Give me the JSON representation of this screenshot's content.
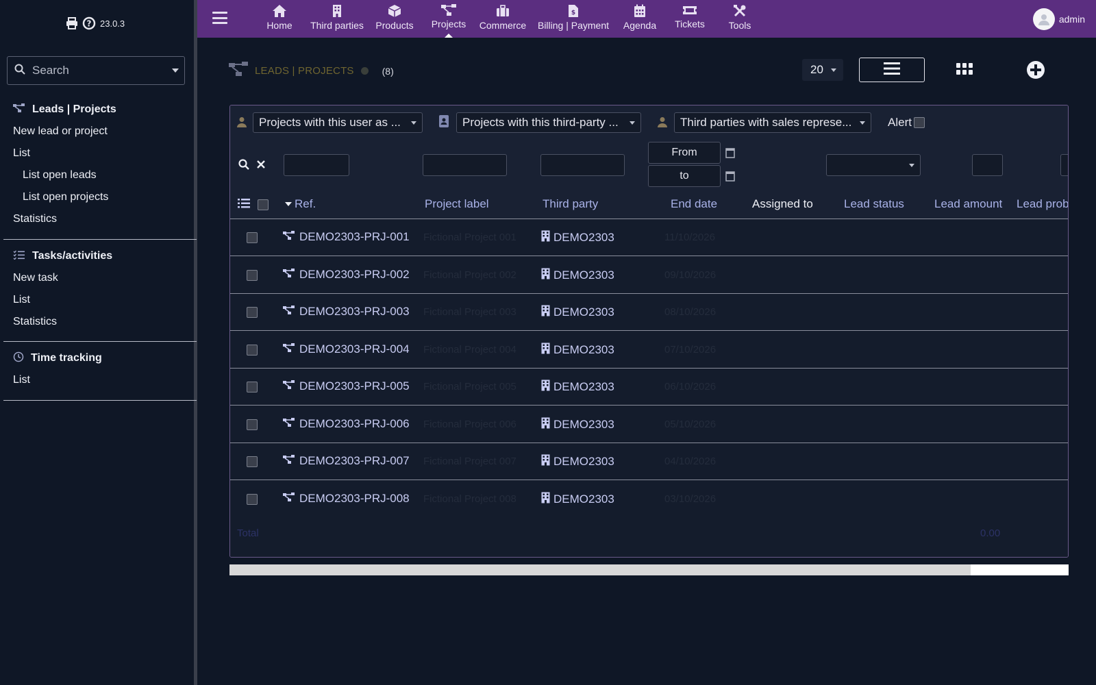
{
  "app": {
    "version": "23.0.3"
  },
  "sidebar": {
    "search_placeholder": "Search",
    "sections": [
      {
        "title": "Leads | Projects",
        "items": [
          {
            "label": "New lead or project",
            "sub": false
          },
          {
            "label": "List",
            "sub": false
          },
          {
            "label": "List open leads",
            "sub": true
          },
          {
            "label": "List open projects",
            "sub": true
          },
          {
            "label": "Statistics",
            "sub": false
          }
        ]
      },
      {
        "title": "Tasks/activities",
        "items": [
          {
            "label": "New task",
            "sub": false
          },
          {
            "label": "List",
            "sub": false
          },
          {
            "label": "Statistics",
            "sub": false
          }
        ]
      },
      {
        "title": "Time tracking",
        "items": [
          {
            "label": "List",
            "sub": false
          }
        ]
      }
    ]
  },
  "topbar": {
    "nav": [
      {
        "label": "Home",
        "icon": "home-icon"
      },
      {
        "label": "Third parties",
        "icon": "building-icon"
      },
      {
        "label": "Products",
        "icon": "cube-icon"
      },
      {
        "label": "Projects",
        "icon": "project-tree-icon",
        "active": true
      },
      {
        "label": "Commerce",
        "icon": "briefcase-icon"
      },
      {
        "label": "Billing | Payment",
        "icon": "invoice-icon"
      },
      {
        "label": "Agenda",
        "icon": "calendar-icon"
      },
      {
        "label": "Tickets",
        "icon": "ticket-icon"
      },
      {
        "label": "Tools",
        "icon": "tools-icon"
      }
    ],
    "user": "admin"
  },
  "page": {
    "title": "LEADS | PROJECTS",
    "count": "(8)",
    "limit": "20"
  },
  "filters": {
    "user_select": "Projects with this user as ...",
    "thirdparty_select": "Projects with this third-party ...",
    "salesrep_select": "Third parties with sales represe...",
    "alert_label": "Alert",
    "date_from": "From",
    "date_to": "to"
  },
  "table": {
    "headers": [
      "Ref.",
      "Project label",
      "Third party",
      "End date",
      "Assigned to",
      "Lead status",
      "Lead amount",
      "Lead prob"
    ],
    "rows": [
      {
        "ref": "DEMO2303-PRJ-001",
        "label": "Fictional Project 001",
        "thirdparty": "DEMO2303",
        "date": "11/10/2026"
      },
      {
        "ref": "DEMO2303-PRJ-002",
        "label": "Fictional Project 002",
        "thirdparty": "DEMO2303",
        "date": "09/10/2026"
      },
      {
        "ref": "DEMO2303-PRJ-003",
        "label": "Fictional Project 003",
        "thirdparty": "DEMO2303",
        "date": "08/10/2026"
      },
      {
        "ref": "DEMO2303-PRJ-004",
        "label": "Fictional Project 004",
        "thirdparty": "DEMO2303",
        "date": "07/10/2026"
      },
      {
        "ref": "DEMO2303-PRJ-005",
        "label": "Fictional Project 005",
        "thirdparty": "DEMO2303",
        "date": "06/10/2026"
      },
      {
        "ref": "DEMO2303-PRJ-006",
        "label": "Fictional Project 006",
        "thirdparty": "DEMO2303",
        "date": "05/10/2026"
      },
      {
        "ref": "DEMO2303-PRJ-007",
        "label": "Fictional Project 007",
        "thirdparty": "DEMO2303",
        "date": "04/10/2026"
      },
      {
        "ref": "DEMO2303-PRJ-008",
        "label": "Fictional Project 008",
        "thirdparty": "DEMO2303",
        "date": "03/10/2026"
      }
    ],
    "total_label": "Total",
    "total_amount": "0.00"
  },
  "colors": {
    "topbar": "#5b2e80",
    "background": "#0f1726",
    "link": "#c8ccf2",
    "header_text": "#a9b2e8"
  }
}
